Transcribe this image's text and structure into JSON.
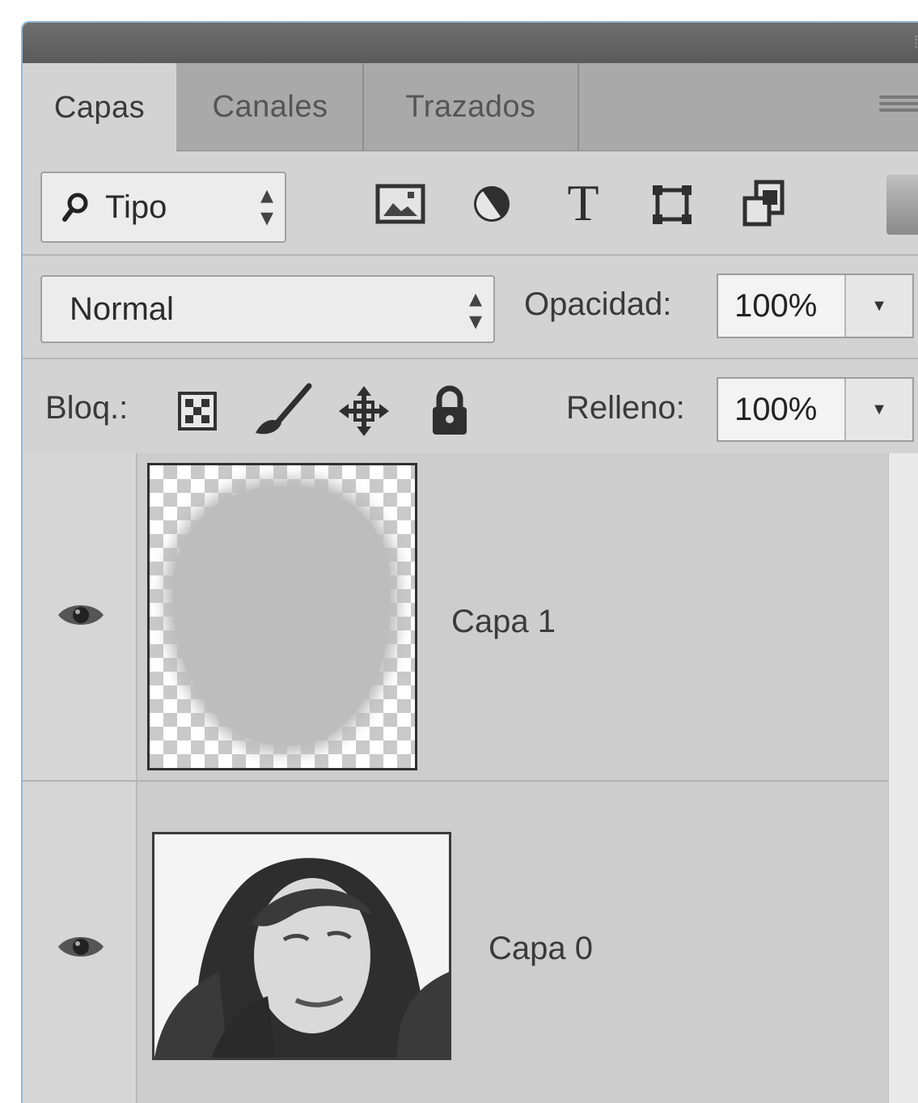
{
  "panel": {
    "tabs": [
      {
        "label": "Capas",
        "active": true
      },
      {
        "label": "Canales",
        "active": false
      },
      {
        "label": "Trazados",
        "active": false
      }
    ]
  },
  "filter": {
    "kind_label": "Tipo",
    "icons": [
      "image-filter-icon",
      "adjustment-filter-icon",
      "type-filter-icon",
      "shape-filter-icon",
      "smart-object-filter-icon"
    ]
  },
  "blend": {
    "mode": "Normal",
    "opacity_label": "Opacidad:",
    "opacity_value": "100%"
  },
  "lock": {
    "label": "Bloq.:",
    "icons": [
      "lock-transparent-pixels-icon",
      "lock-image-pixels-icon",
      "lock-position-icon",
      "lock-all-icon"
    ],
    "fill_label": "Relleno:",
    "fill_value": "100%"
  },
  "layers": [
    {
      "name": "Capa 1",
      "visible": true,
      "thumbnail": "transparent-mask"
    },
    {
      "name": "Capa 0",
      "visible": true,
      "thumbnail": "portrait-photo"
    }
  ]
}
